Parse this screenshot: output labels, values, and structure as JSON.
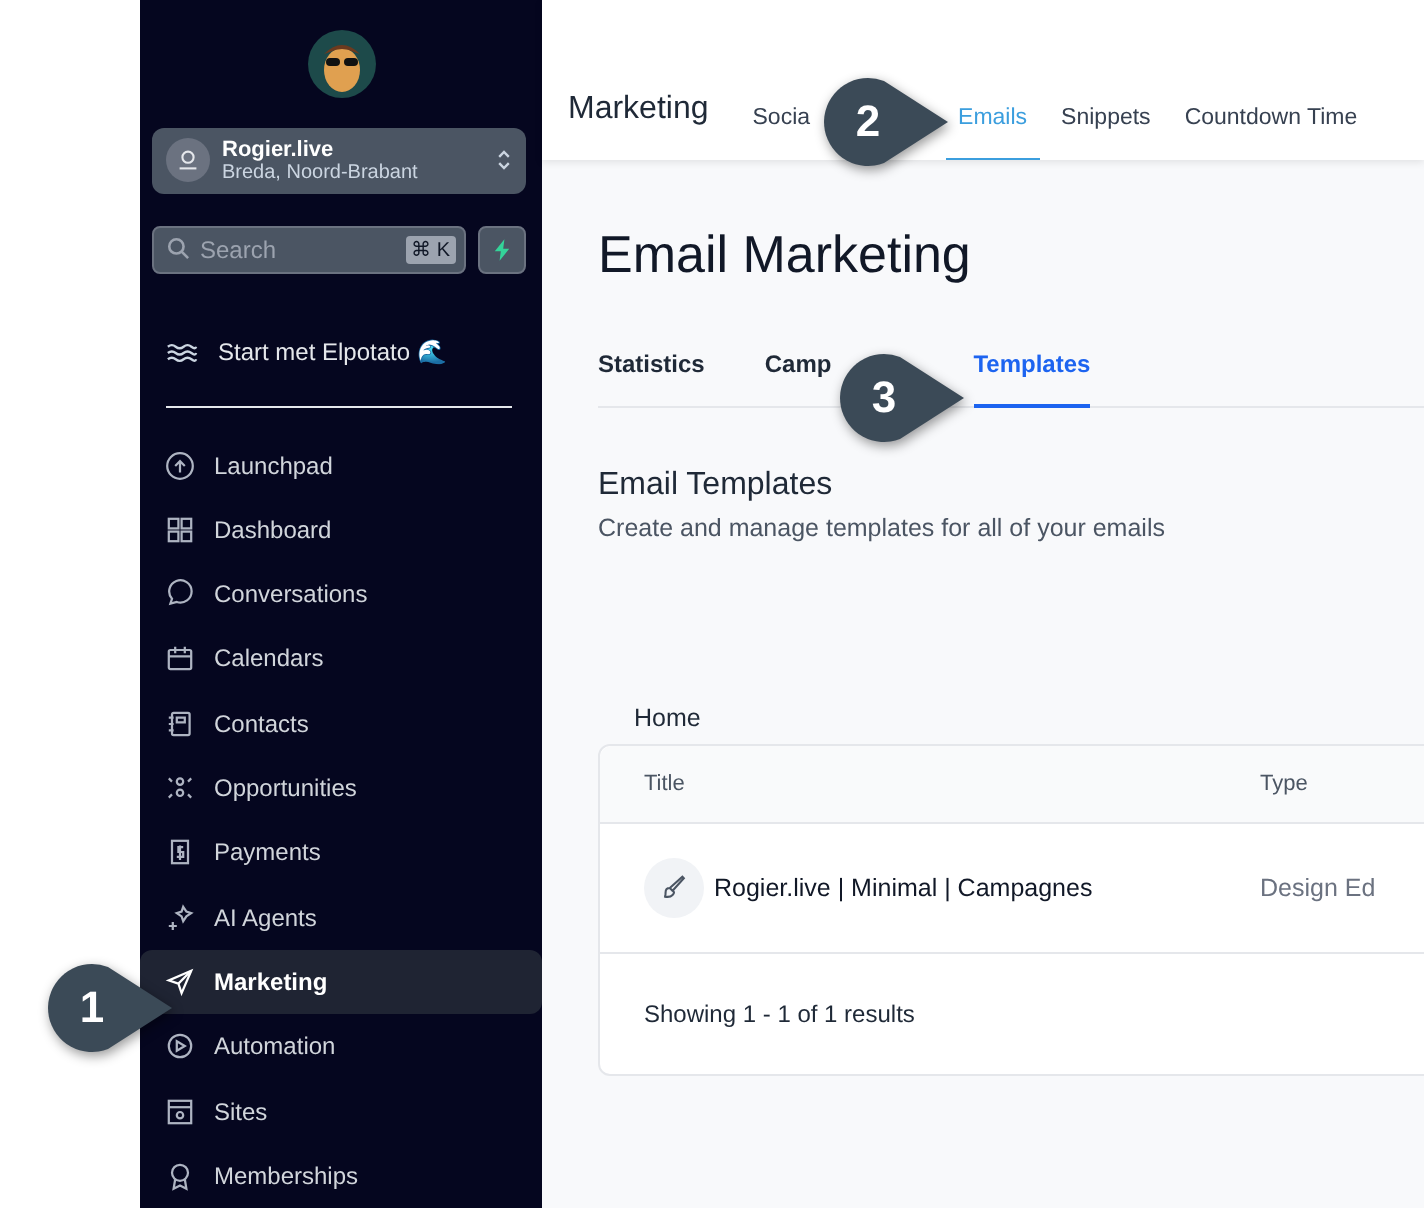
{
  "sidebar": {
    "account": {
      "name": "Rogier.live",
      "location": "Breda, Noord-Brabant"
    },
    "search": {
      "placeholder": "Search",
      "shortcut": "⌘ K"
    },
    "start_item": "Start met Elpotato 🌊",
    "items": [
      {
        "label": "Launchpad",
        "selected": false
      },
      {
        "label": "Dashboard",
        "selected": false
      },
      {
        "label": "Conversations",
        "selected": false
      },
      {
        "label": "Calendars",
        "selected": false
      },
      {
        "label": "Contacts",
        "selected": false
      },
      {
        "label": "Opportunities",
        "selected": false
      },
      {
        "label": "Payments",
        "selected": false
      },
      {
        "label": "AI Agents",
        "selected": false
      },
      {
        "label": "Marketing",
        "selected": true
      },
      {
        "label": "Automation",
        "selected": false
      },
      {
        "label": "Sites",
        "selected": false
      },
      {
        "label": "Memberships",
        "selected": false
      }
    ]
  },
  "header": {
    "title": "Marketing",
    "tabs": [
      {
        "label": "Socia",
        "selected": false
      },
      {
        "label": "Emails",
        "selected": true
      },
      {
        "label": "Snippets",
        "selected": false
      },
      {
        "label": "Countdown Time",
        "selected": false
      }
    ]
  },
  "page": {
    "title": "Email Marketing",
    "tabs": [
      {
        "label": "Statistics",
        "selected": false
      },
      {
        "label": "Camp",
        "selected": false
      },
      {
        "label": "Templates",
        "selected": true
      }
    ],
    "section_title": "Email Templates",
    "section_subtitle": "Create and manage templates for all of your emails",
    "breadcrumb": "Home",
    "table": {
      "columns": [
        "Title",
        "Type"
      ],
      "rows": [
        {
          "title": "Rogier.live | Minimal | Campagnes",
          "type": "Design Ed"
        }
      ],
      "footer": "Showing 1 - 1 of 1 results"
    }
  },
  "callouts": [
    "1",
    "2",
    "3"
  ]
}
